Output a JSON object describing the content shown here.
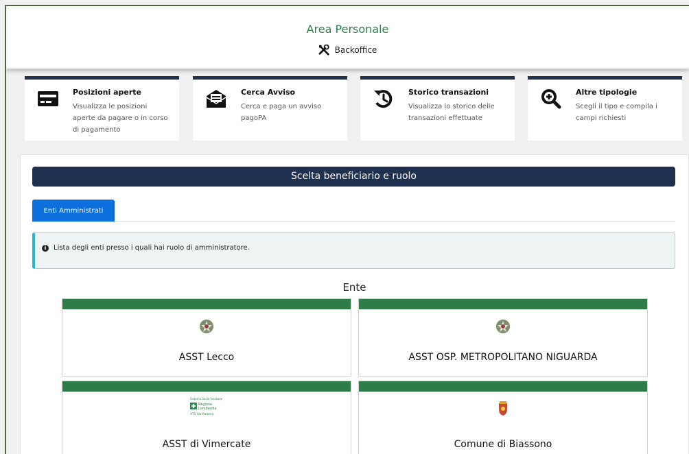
{
  "header": {
    "title": "Area Personale",
    "subtitle": "Backoffice"
  },
  "cards": [
    {
      "title": "Posizioni aperte",
      "desc": "Visualizza le posizioni aperte da pagare o in corso di pagamento",
      "icon": "credit-card-icon"
    },
    {
      "title": "Cerca Avviso",
      "desc": "Cerca e paga un avviso pagoPA",
      "icon": "envelope-icon"
    },
    {
      "title": "Storico transazioni",
      "desc": "Visualizza lo storico delle transazioni effettuate",
      "icon": "history-icon"
    },
    {
      "title": "Altre tipologie",
      "desc": "Scegli il tipo e compila i campi richiesti",
      "icon": "zoom-in-icon"
    }
  ],
  "panel": {
    "section_title": "Scelta beneficiario e ruolo",
    "tab_label": "Enti Amministrati",
    "info_text": "Lista degli enti presso i quali hai ruolo di amministratore.",
    "ente_header": "Ente"
  },
  "enti": [
    {
      "name": "ASST Lecco",
      "logo": "italian-emblem-icon"
    },
    {
      "name": "ASST OSP. METROPOLITANO NIGUARDA",
      "logo": "italian-emblem-icon"
    },
    {
      "name": "ASST di Vimercate",
      "logo": "regione-lombardia-logo",
      "logo_text": [
        "Sistema Socio Sanitario",
        "Regione",
        "Lombardia",
        "ATS Val Padana"
      ]
    },
    {
      "name": "Comune di Biassono",
      "logo": "comune-crest-icon"
    }
  ],
  "colors": {
    "accent_green": "#2e7d46",
    "navy": "#1f3050",
    "button_blue": "#0b6fdd",
    "info_border": "#28b8c4"
  }
}
